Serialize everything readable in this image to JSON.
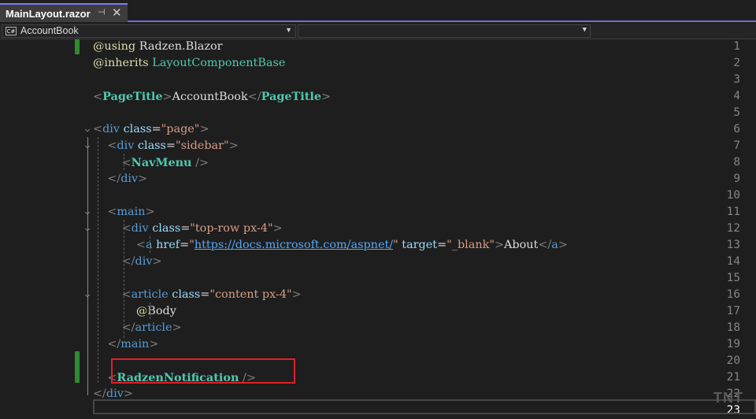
{
  "tab": {
    "title": "MainLayout.razor",
    "pin_icon": "pin-icon",
    "close_icon": "close-icon"
  },
  "navbar": {
    "project": "AccountBook",
    "project_icon": "C#",
    "member": ""
  },
  "lines": [
    {
      "n": "1",
      "parts": [
        [
          "at",
          "@using"
        ],
        [
          "plain",
          " Radzen.Blazor"
        ]
      ]
    },
    {
      "n": "2",
      "parts": [
        [
          "at",
          "@inherits"
        ],
        [
          "plain",
          " "
        ],
        [
          "comp2",
          "LayoutComponentBase"
        ]
      ]
    },
    {
      "n": "3",
      "parts": []
    },
    {
      "n": "4",
      "parts": [
        [
          "tagb",
          "<"
        ],
        [
          "comp",
          "PageTitle"
        ],
        [
          "tagb",
          ">"
        ],
        [
          "plain",
          "AccountBook"
        ],
        [
          "tagb",
          "</"
        ],
        [
          "comp",
          "PageTitle"
        ],
        [
          "tagb",
          ">"
        ]
      ]
    },
    {
      "n": "5",
      "parts": []
    },
    {
      "n": "6",
      "parts": [
        [
          "tagb",
          "<"
        ],
        [
          "tag",
          "div"
        ],
        [
          "plain",
          " "
        ],
        [
          "attr",
          "class"
        ],
        [
          "plain",
          "="
        ],
        [
          "str",
          "\"page\""
        ],
        [
          "tagb",
          ">"
        ]
      ]
    },
    {
      "n": "7",
      "parts": [
        [
          "plain",
          "    "
        ],
        [
          "tagb",
          "<"
        ],
        [
          "tag",
          "div"
        ],
        [
          "plain",
          " "
        ],
        [
          "attr",
          "class"
        ],
        [
          "plain",
          "="
        ],
        [
          "str",
          "\"sidebar\""
        ],
        [
          "tagb",
          ">"
        ]
      ]
    },
    {
      "n": "8",
      "parts": [
        [
          "plain",
          "        "
        ],
        [
          "tagb",
          "<"
        ],
        [
          "comp",
          "NavMenu"
        ],
        [
          "plain",
          " "
        ],
        [
          "tagb",
          "/>"
        ]
      ]
    },
    {
      "n": "9",
      "parts": [
        [
          "plain",
          "    "
        ],
        [
          "tagb",
          "</"
        ],
        [
          "tag",
          "div"
        ],
        [
          "tagb",
          ">"
        ]
      ]
    },
    {
      "n": "10",
      "parts": []
    },
    {
      "n": "11",
      "parts": [
        [
          "plain",
          "    "
        ],
        [
          "tagb",
          "<"
        ],
        [
          "tag",
          "main"
        ],
        [
          "tagb",
          ">"
        ]
      ]
    },
    {
      "n": "12",
      "parts": [
        [
          "plain",
          "        "
        ],
        [
          "tagb",
          "<"
        ],
        [
          "tag",
          "div"
        ],
        [
          "plain",
          " "
        ],
        [
          "attr",
          "class"
        ],
        [
          "plain",
          "="
        ],
        [
          "str",
          "\"top-row px-4\""
        ],
        [
          "tagb",
          ">"
        ]
      ]
    },
    {
      "n": "13",
      "parts": [
        [
          "plain",
          "            "
        ],
        [
          "tagb",
          "<"
        ],
        [
          "tag",
          "a"
        ],
        [
          "plain",
          " "
        ],
        [
          "attr",
          "href"
        ],
        [
          "plain",
          "="
        ],
        [
          "str",
          "\""
        ],
        [
          "link",
          "https://docs.microsoft.com/aspnet/"
        ],
        [
          "str",
          "\""
        ],
        [
          "plain",
          " "
        ],
        [
          "attr",
          "target"
        ],
        [
          "plain",
          "="
        ],
        [
          "str",
          "\"_blank\""
        ],
        [
          "tagb",
          ">"
        ],
        [
          "plain",
          "About"
        ],
        [
          "tagb",
          "</"
        ],
        [
          "tag",
          "a"
        ],
        [
          "tagb",
          ">"
        ]
      ]
    },
    {
      "n": "14",
      "parts": [
        [
          "plain",
          "        "
        ],
        [
          "tagb",
          "</"
        ],
        [
          "tag",
          "div"
        ],
        [
          "tagb",
          ">"
        ]
      ]
    },
    {
      "n": "15",
      "parts": []
    },
    {
      "n": "16",
      "parts": [
        [
          "plain",
          "        "
        ],
        [
          "tagb",
          "<"
        ],
        [
          "tag",
          "article"
        ],
        [
          "plain",
          " "
        ],
        [
          "attr",
          "class"
        ],
        [
          "plain",
          "="
        ],
        [
          "str",
          "\"content px-4\""
        ],
        [
          "tagb",
          ">"
        ]
      ]
    },
    {
      "n": "17",
      "parts": [
        [
          "plain",
          "            "
        ],
        [
          "at",
          "@"
        ],
        [
          "plain",
          "Body"
        ]
      ]
    },
    {
      "n": "18",
      "parts": [
        [
          "plain",
          "        "
        ],
        [
          "tagb",
          "</"
        ],
        [
          "tag",
          "article"
        ],
        [
          "tagb",
          ">"
        ]
      ]
    },
    {
      "n": "19",
      "parts": [
        [
          "plain",
          "    "
        ],
        [
          "tagb",
          "</"
        ],
        [
          "tag",
          "main"
        ],
        [
          "tagb",
          ">"
        ]
      ]
    },
    {
      "n": "20",
      "parts": []
    },
    {
      "n": "21",
      "parts": [
        [
          "plain",
          "    "
        ],
        [
          "tagb",
          "<"
        ],
        [
          "comp",
          "RadzenNotification"
        ],
        [
          "plain",
          " "
        ],
        [
          "tagb",
          "/>"
        ]
      ]
    },
    {
      "n": "22",
      "parts": [
        [
          "tagb",
          "</"
        ],
        [
          "tag",
          "div"
        ],
        [
          "tagb",
          ">"
        ]
      ]
    },
    {
      "n": "23",
      "parts": []
    }
  ],
  "watermark": "TNT",
  "colors": {
    "accent": "#7b7bff",
    "change_bar": "#2e8b2e",
    "highlight_box": "#e0202a"
  }
}
